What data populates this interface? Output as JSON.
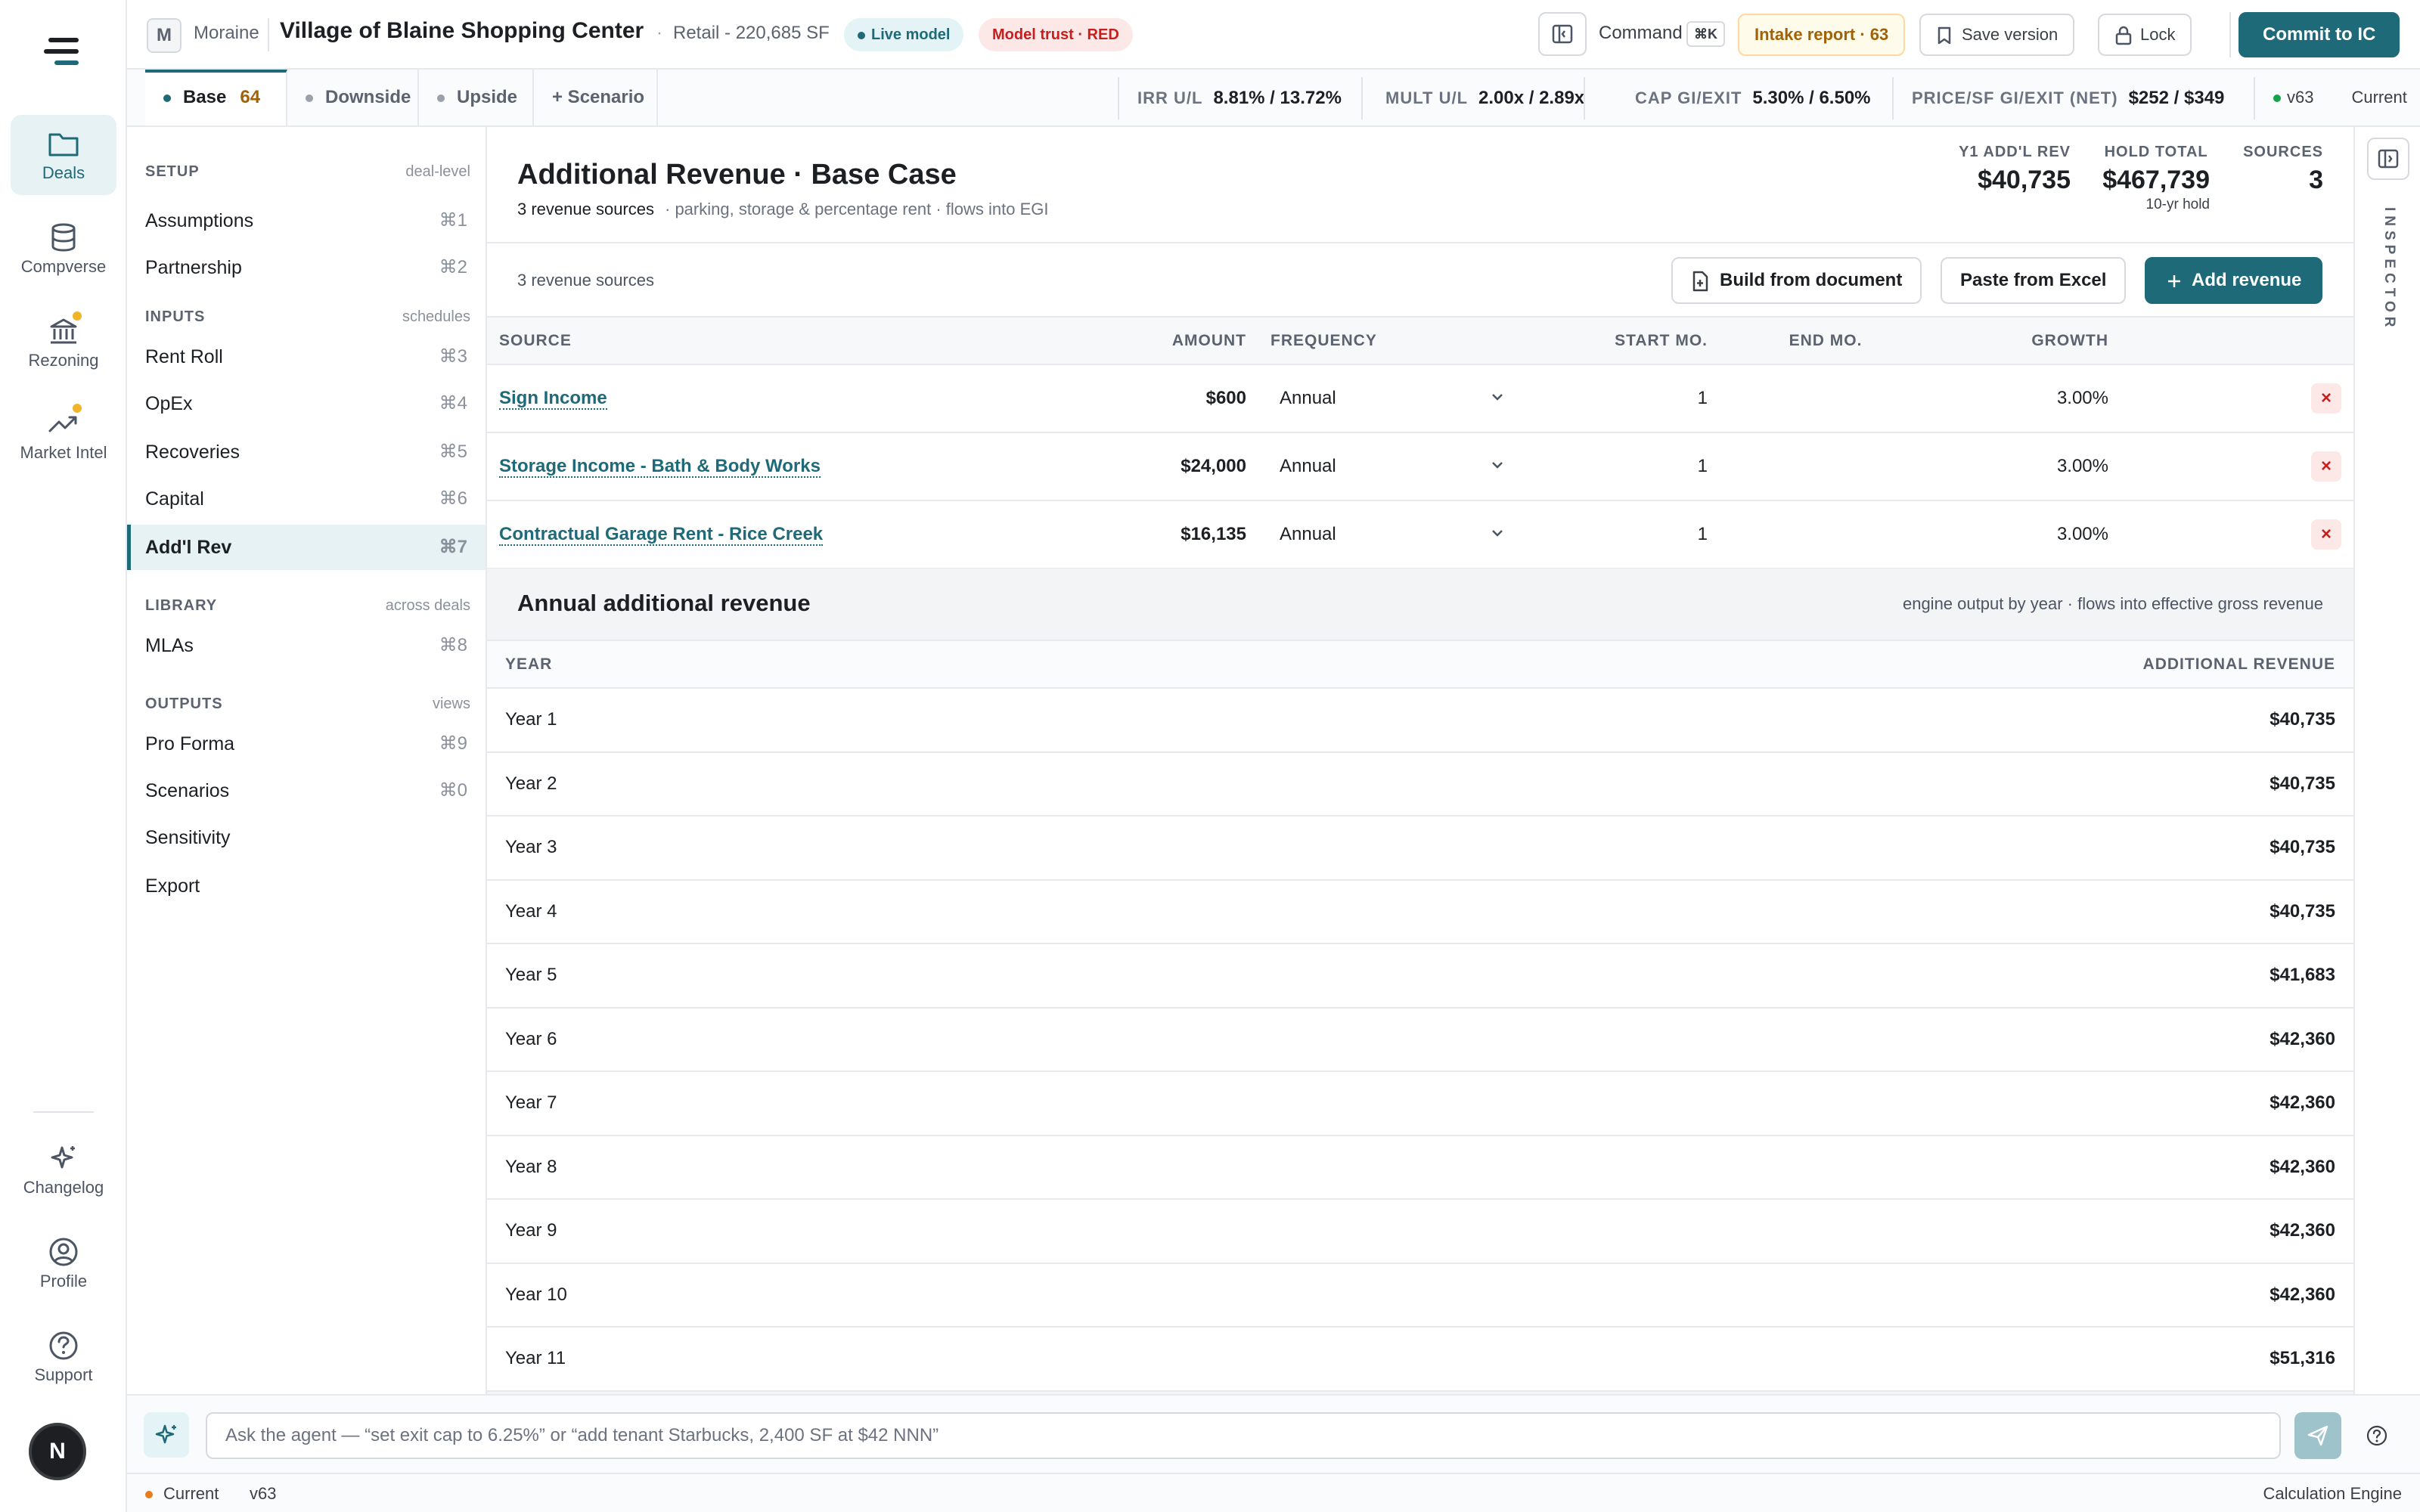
{
  "rail": {
    "items": [
      {
        "label": "Deals"
      },
      {
        "label": "Compverse"
      },
      {
        "label": "Rezoning"
      },
      {
        "label": "Market Intel"
      },
      {
        "label": "Changelog"
      },
      {
        "label": "Profile"
      },
      {
        "label": "Support"
      }
    ],
    "avatar": "N"
  },
  "topbar": {
    "badge": "M",
    "org": "Moraine",
    "title": "Village of Blaine Shopping Center",
    "sep": "·",
    "subtitle": "Retail - 220,685 SF",
    "live_pill": "Live model",
    "trust_pill": "Model trust · RED",
    "command_label": "Command",
    "command_kbd": "⌘K",
    "intake": "Intake report · 63",
    "save": "Save version",
    "lock": "Lock",
    "commit": "Commit to IC"
  },
  "tabs": [
    {
      "label": "Base",
      "count": "64"
    },
    {
      "label": "Downside"
    },
    {
      "label": "Upside"
    },
    {
      "label": "+ Scenario"
    }
  ],
  "metrics": [
    {
      "label": "IRR U/L",
      "value": "8.81% / 13.72%"
    },
    {
      "label": "MULT U/L",
      "value": "2.00x / 2.89x"
    },
    {
      "label": "CAP GI/EXIT",
      "value": "5.30% / 6.50%"
    },
    {
      "label": "PRICE/SF GI/EXIT (NET)",
      "value": "$252 / $349"
    }
  ],
  "version": {
    "tag": "v63",
    "state": "Current"
  },
  "nav": {
    "setup": {
      "title": "SETUP",
      "hint": "deal-level"
    },
    "inputs": {
      "title": "INPUTS",
      "hint": "schedules"
    },
    "library": {
      "title": "LIBRARY",
      "hint": "across deals"
    },
    "outputs": {
      "title": "OUTPUTS",
      "hint": "views"
    },
    "items": [
      {
        "label": "Assumptions",
        "kbd": "⌘1"
      },
      {
        "label": "Partnership",
        "kbd": "⌘2"
      },
      {
        "label": "Rent Roll",
        "kbd": "⌘3"
      },
      {
        "label": "OpEx",
        "kbd": "⌘4"
      },
      {
        "label": "Recoveries",
        "kbd": "⌘5"
      },
      {
        "label": "Capital",
        "kbd": "⌘6"
      },
      {
        "label": "Add'l Rev",
        "kbd": "⌘7"
      },
      {
        "label": "MLAs",
        "kbd": "⌘8"
      },
      {
        "label": "Pro Forma",
        "kbd": "⌘9"
      },
      {
        "label": "Scenarios",
        "kbd": "⌘0"
      },
      {
        "label": "Sensitivity",
        "kbd": ""
      },
      {
        "label": "Export",
        "kbd": ""
      }
    ]
  },
  "page": {
    "title": "Additional Revenue · Base Case",
    "sub_count": "3 revenue sources",
    "sub_note": "·   parking, storage & percentage rent · flows into EGI",
    "kpis": [
      {
        "label": "Y1 ADD'L REV",
        "value": "$40,735",
        "sub": ""
      },
      {
        "label": "HOLD TOTAL",
        "value": "$467,739",
        "sub": "10-yr hold"
      },
      {
        "label": "SOURCES",
        "value": "3",
        "sub": ""
      }
    ],
    "toolbar_count": "3 revenue sources",
    "build_btn": "Build from document",
    "paste_btn": "Paste from Excel",
    "add_btn": "Add revenue"
  },
  "revenue_table": {
    "headers": {
      "source": "SOURCE",
      "amount": "AMOUNT",
      "frequency": "FREQUENCY",
      "start": "START MO.",
      "end": "END MO.",
      "growth": "GROWTH"
    },
    "rows": [
      {
        "source": "Sign Income",
        "amount": "$600",
        "frequency": "Annual",
        "start": "1",
        "end": "",
        "growth": "3.00%"
      },
      {
        "source": "Storage Income - Bath & Body Works",
        "amount": "$24,000",
        "frequency": "Annual",
        "start": "1",
        "end": "",
        "growth": "3.00%"
      },
      {
        "source": "Contractual Garage Rent - Rice Creek",
        "amount": "$16,135",
        "frequency": "Annual",
        "start": "1",
        "end": "",
        "growth": "3.00%"
      }
    ],
    "delete_glyph": "×"
  },
  "annual": {
    "title": "Annual additional revenue",
    "note": "engine output by year · flows into effective gross revenue",
    "headers": {
      "year": "YEAR",
      "value": "ADDITIONAL REVENUE"
    },
    "rows": [
      {
        "year": "Year 1",
        "value": "$40,735"
      },
      {
        "year": "Year 2",
        "value": "$40,735"
      },
      {
        "year": "Year 3",
        "value": "$40,735"
      },
      {
        "year": "Year 4",
        "value": "$40,735"
      },
      {
        "year": "Year 5",
        "value": "$41,683"
      },
      {
        "year": "Year 6",
        "value": "$42,360"
      },
      {
        "year": "Year 7",
        "value": "$42,360"
      },
      {
        "year": "Year 8",
        "value": "$42,360"
      },
      {
        "year": "Year 9",
        "value": "$42,360"
      },
      {
        "year": "Year 10",
        "value": "$42,360"
      },
      {
        "year": "Year 11",
        "value": "$51,316"
      }
    ]
  },
  "inspector": {
    "label": "INSPECTOR"
  },
  "agent": {
    "placeholder": "Ask the agent — “set exit cap to 6.25%” or “add tenant Starbucks, 2,400 SF at $42 NNN”"
  },
  "status": {
    "state": "Current",
    "version": "v63",
    "engine": "Calculation Engine"
  },
  "colors": {
    "accent": "#1f6a78",
    "danger": "#c81e1e",
    "warning": "#f0b429"
  }
}
